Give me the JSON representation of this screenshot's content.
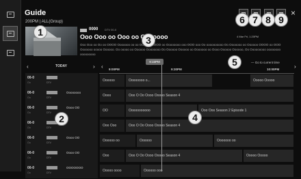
{
  "header": {
    "title": "Guide",
    "subtitle": "200PM | ALL(Group)",
    "close": "×"
  },
  "rail": {
    "items": [
      {
        "icon": "list-icon",
        "active": false
      },
      {
        "icon": "guide-icon",
        "active": true
      },
      {
        "icon": "schedule-icon",
        "active": false
      }
    ]
  },
  "program": {
    "channel_number": "0000",
    "channel_sub": "DTV 00-0",
    "title": "Ooo Ooo oo Ooo oo Ooooooo",
    "meta": "4 Mar Fri, 1:20PM",
    "description": "Ooo Ooo oo Oo oo OOOO Ooooooo oo oo OOOOOOOOO oo Oooooooo ooo OOO ooo Oo oooooooooo Oo Ooooooo oo Oooooo OOOO oo OOO Ooooooo ooooo Oooooo. Oo ooooo oo Oooooo Oooooooo Oo Oooooo Oooooo oo Ooooooo oo Oooo Oooooo Oooooo, Oo Ooooooooo oooooooo ooooooooo"
  },
  "actions": [
    {
      "name": "record-icon"
    },
    {
      "name": "filter-icon"
    },
    {
      "name": "channel-list-icon"
    },
    {
      "name": "schedule-list-icon"
    }
  ],
  "callouts": [
    "1",
    "2",
    "3",
    "4",
    "5",
    "6",
    "7",
    "8",
    "9"
  ],
  "day_nav": {
    "label": "TODAY",
    "prev": "‹",
    "next": "›"
  },
  "timeline": {
    "prev": "‹",
    "now_badge": "9:15PM",
    "ticks": [
      "9:00PM",
      "9:30PM",
      "10:00PM"
    ],
    "current_time_link": "— Go to current time",
    "next": "›"
  },
  "channels": [
    {
      "number": "00-0",
      "sub": "Oo",
      "name": "",
      "type": "DTV"
    },
    {
      "number": "00-0",
      "sub": "Oo",
      "name": "Oooooooo",
      "type": "DTV"
    },
    {
      "number": "00-0",
      "sub": "Oo",
      "name": "Oooo OO",
      "type": "DTV"
    },
    {
      "number": "00-0",
      "sub": "Oo",
      "name": "",
      "type": "DTV"
    },
    {
      "number": "00-0",
      "sub": "Oo",
      "name": "Oooo OO",
      "type": "DTV"
    },
    {
      "number": "00-0",
      "sub": "Oo",
      "name": "Oooo OO",
      "type": "DTV"
    },
    {
      "number": "00-0",
      "sub": "Oo",
      "name": "OOOOOOO",
      "type": "DTV"
    }
  ],
  "grid": [
    [
      "Oooooo",
      "Oooooooo o...",
      "Ooooo Ooooo"
    ],
    [
      "Oooo",
      "Ooo O Oo Oooo Ooooo Season 4"
    ],
    [
      "OO",
      "Ooooooooooo",
      "Ooo Ooo Season 2 Episode 1"
    ],
    [
      "Ooo Ooo",
      "Ooo O Oo Oooo Ooooo Season 4"
    ],
    [
      "Oooooo oo",
      "Oooooo",
      "Ooooooo oo"
    ],
    [
      "Ooo",
      "Ooo O Oo Oooo Ooooo Season 4",
      "Ooooo Ooooo"
    ],
    [
      "Ooooo oooo",
      "Oooooo ooo"
    ]
  ]
}
